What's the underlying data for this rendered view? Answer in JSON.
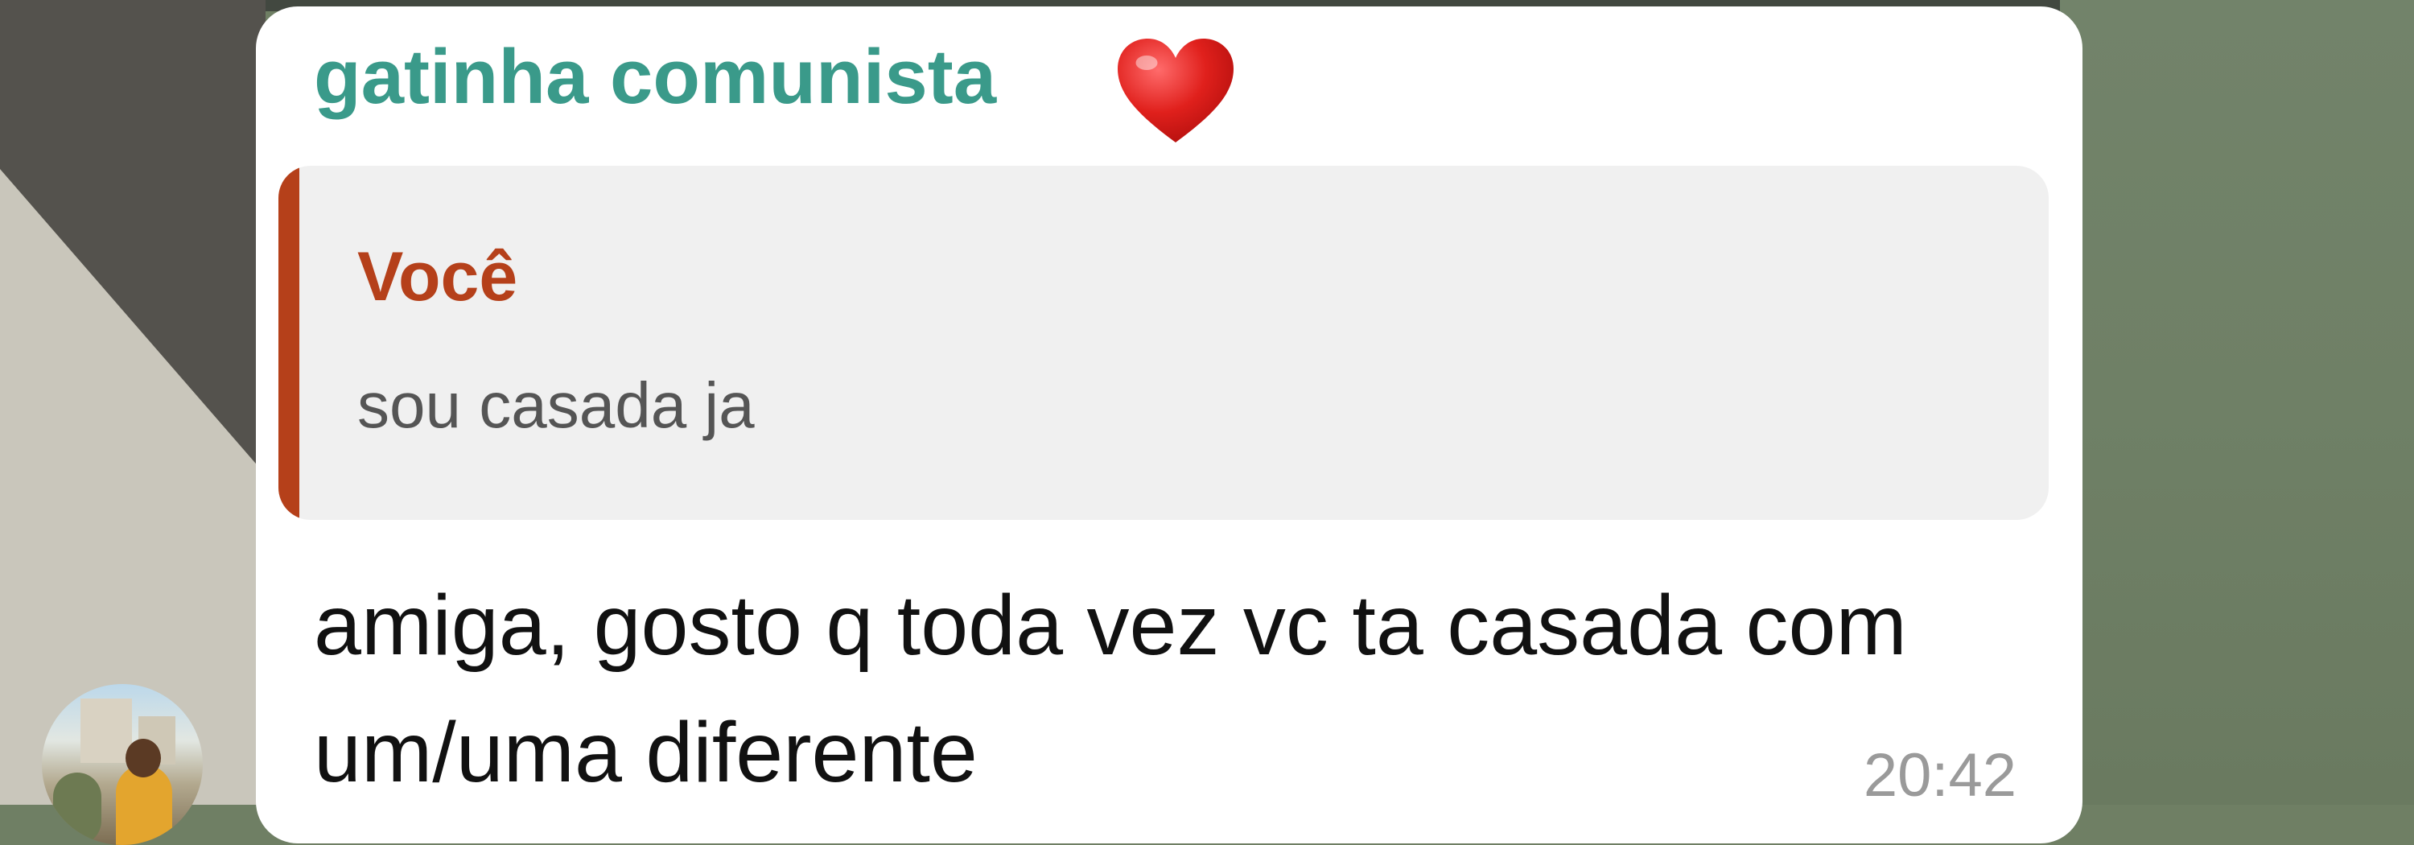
{
  "message": {
    "sender_name": "gatinha comunista",
    "sender_emoji": "heart-icon",
    "sender_color": "#3a9a8a",
    "reply": {
      "author": "Você",
      "text": "sou casada ja",
      "accent_color": "#b5401a"
    },
    "body": "amiga, gosto q toda vez vc ta casada com um/uma diferente",
    "time": "20:42"
  }
}
